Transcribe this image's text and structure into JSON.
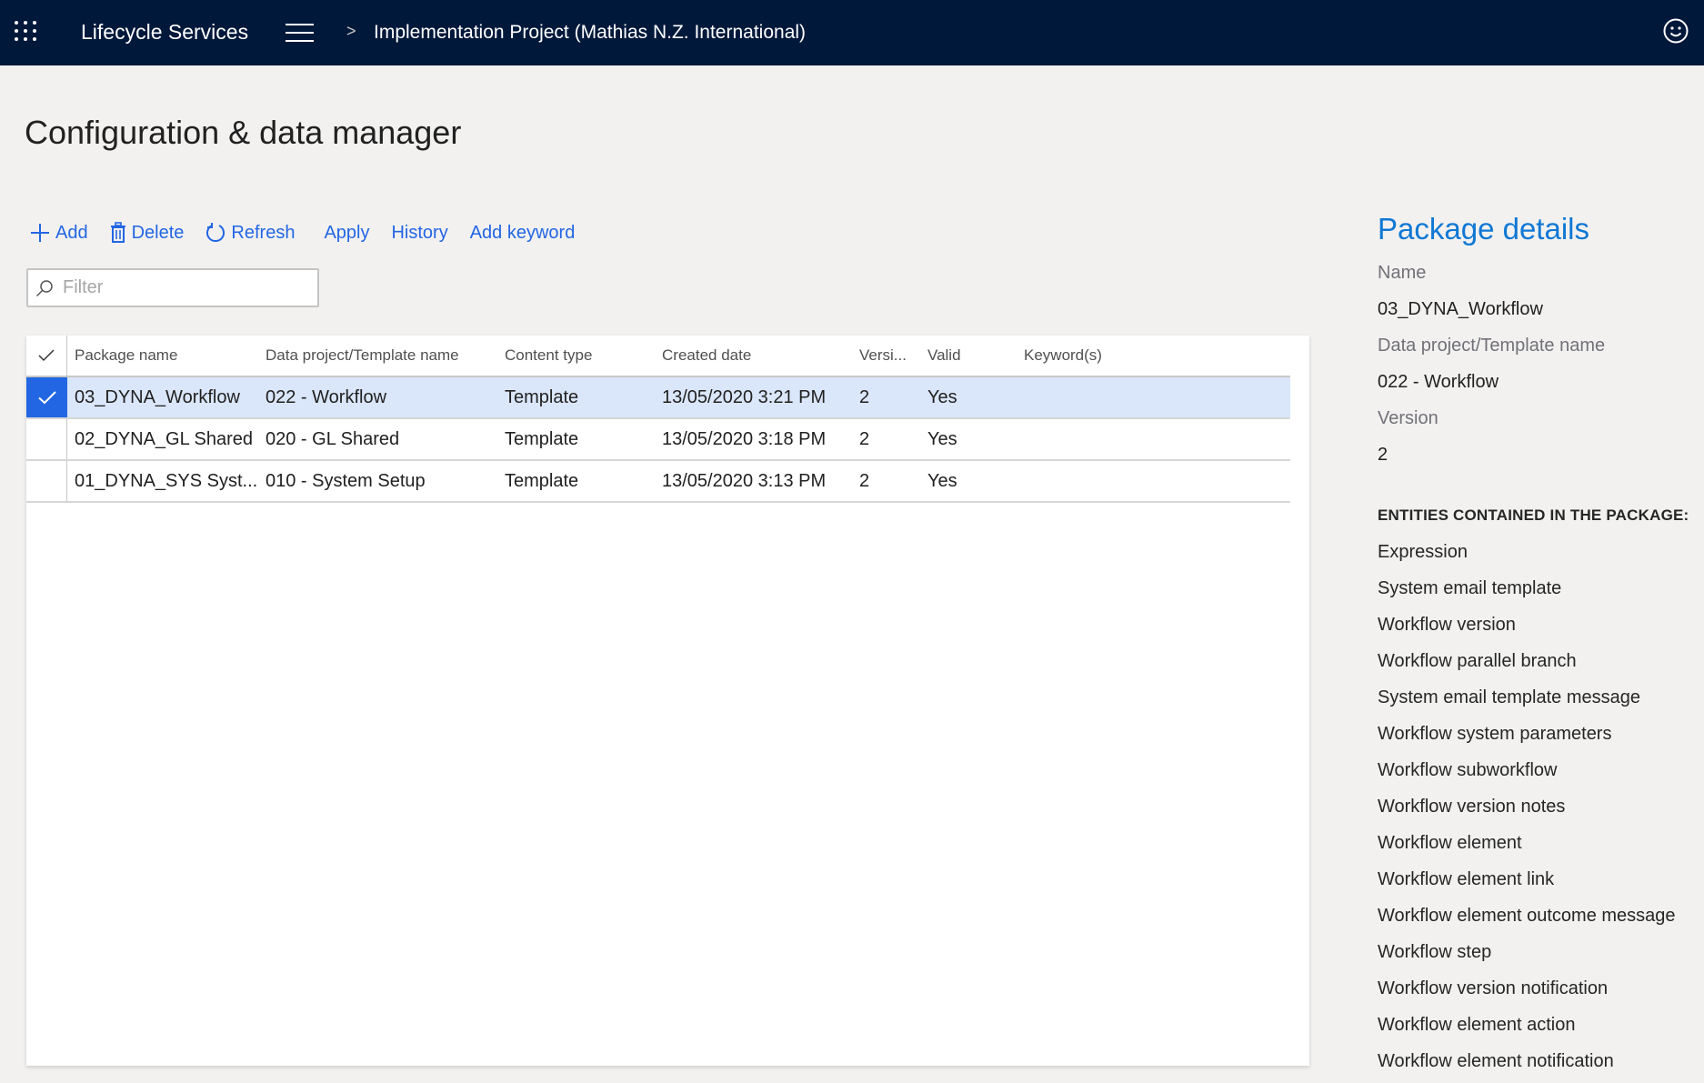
{
  "topbar": {
    "app_title": "Lifecycle Services",
    "breadcrumb_separator": ">",
    "breadcrumb": "Implementation Project (Mathias N.Z. International)",
    "icons": [
      "app-launcher-icon",
      "hamburger-menu-icon",
      "chevron-right-icon",
      "feedback-smiley-icon"
    ]
  },
  "page": {
    "title": "Configuration & data manager"
  },
  "toolbar": {
    "add": "Add",
    "delete": "Delete",
    "refresh": "Refresh",
    "apply": "Apply",
    "history": "History",
    "add_keyword": "Add keyword"
  },
  "filter": {
    "placeholder": "Filter",
    "value": ""
  },
  "grid": {
    "columns": [
      "Package name",
      "Data project/Template name",
      "Content type",
      "Created date",
      "Versi...",
      "Valid",
      "Keyword(s)"
    ],
    "rows": [
      {
        "selected": true,
        "package_name": "03_DYNA_Workflow",
        "template_name": "022 - Workflow",
        "content_type": "Template",
        "created_date": "13/05/2020 3:21 PM",
        "version": "2",
        "valid": "Yes",
        "keywords": ""
      },
      {
        "selected": false,
        "package_name": "02_DYNA_GL Shared",
        "template_name": "020 - GL Shared",
        "content_type": "Template",
        "created_date": "13/05/2020 3:18 PM",
        "version": "2",
        "valid": "Yes",
        "keywords": ""
      },
      {
        "selected": false,
        "package_name": "01_DYNA_SYS Syst...",
        "template_name": "010 - System Setup",
        "content_type": "Template",
        "created_date": "13/05/2020 3:13 PM",
        "version": "2",
        "valid": "Yes",
        "keywords": ""
      }
    ]
  },
  "details": {
    "title": "Package details",
    "name_label": "Name",
    "name_value": "03_DYNA_Workflow",
    "template_label": "Data project/Template name",
    "template_value": "022 - Workflow",
    "version_label": "Version",
    "version_value": "2",
    "entities_title": "ENTITIES CONTAINED IN THE PACKAGE:",
    "entities": [
      "Expression",
      "System email template",
      "Workflow version",
      "Workflow parallel branch",
      "System email template message",
      "Workflow system parameters",
      "Workflow subworkflow",
      "Workflow version notes",
      "Workflow element",
      "Workflow element link",
      "Workflow element outcome message",
      "Workflow step",
      "Workflow version notification",
      "Workflow element action",
      "Workflow element notification"
    ]
  },
  "colors": {
    "topbar_bg": "#00183a",
    "accent_blue": "#2266e3",
    "details_title": "#0f78d4",
    "selected_row_bg": "#dae6fa",
    "page_bg": "#f2f1f0"
  }
}
